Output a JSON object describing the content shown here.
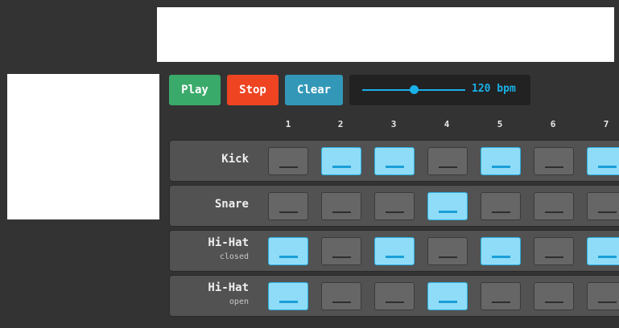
{
  "controls": {
    "play_label": "Play",
    "stop_label": "Stop",
    "clear_label": "Clear",
    "bpm_text": "120 bpm",
    "tempo_bpm": 120
  },
  "colors": {
    "play": "#3aaa6a",
    "stop": "#ee4422",
    "clear": "#3398b8",
    "accent": "#1ab0e8"
  },
  "step_numbers": [
    "1",
    "2",
    "3",
    "4",
    "5",
    "6",
    "7"
  ],
  "tracks": [
    {
      "name": "Kick",
      "sub": "",
      "steps": [
        false,
        true,
        true,
        false,
        true,
        false,
        true
      ]
    },
    {
      "name": "Snare",
      "sub": "",
      "steps": [
        false,
        false,
        false,
        true,
        false,
        false,
        false
      ]
    },
    {
      "name": "Hi-Hat",
      "sub": "closed",
      "steps": [
        true,
        false,
        true,
        false,
        true,
        false,
        true
      ]
    },
    {
      "name": "Hi-Hat",
      "sub": "open",
      "steps": [
        true,
        false,
        false,
        true,
        false,
        false,
        false
      ]
    }
  ]
}
